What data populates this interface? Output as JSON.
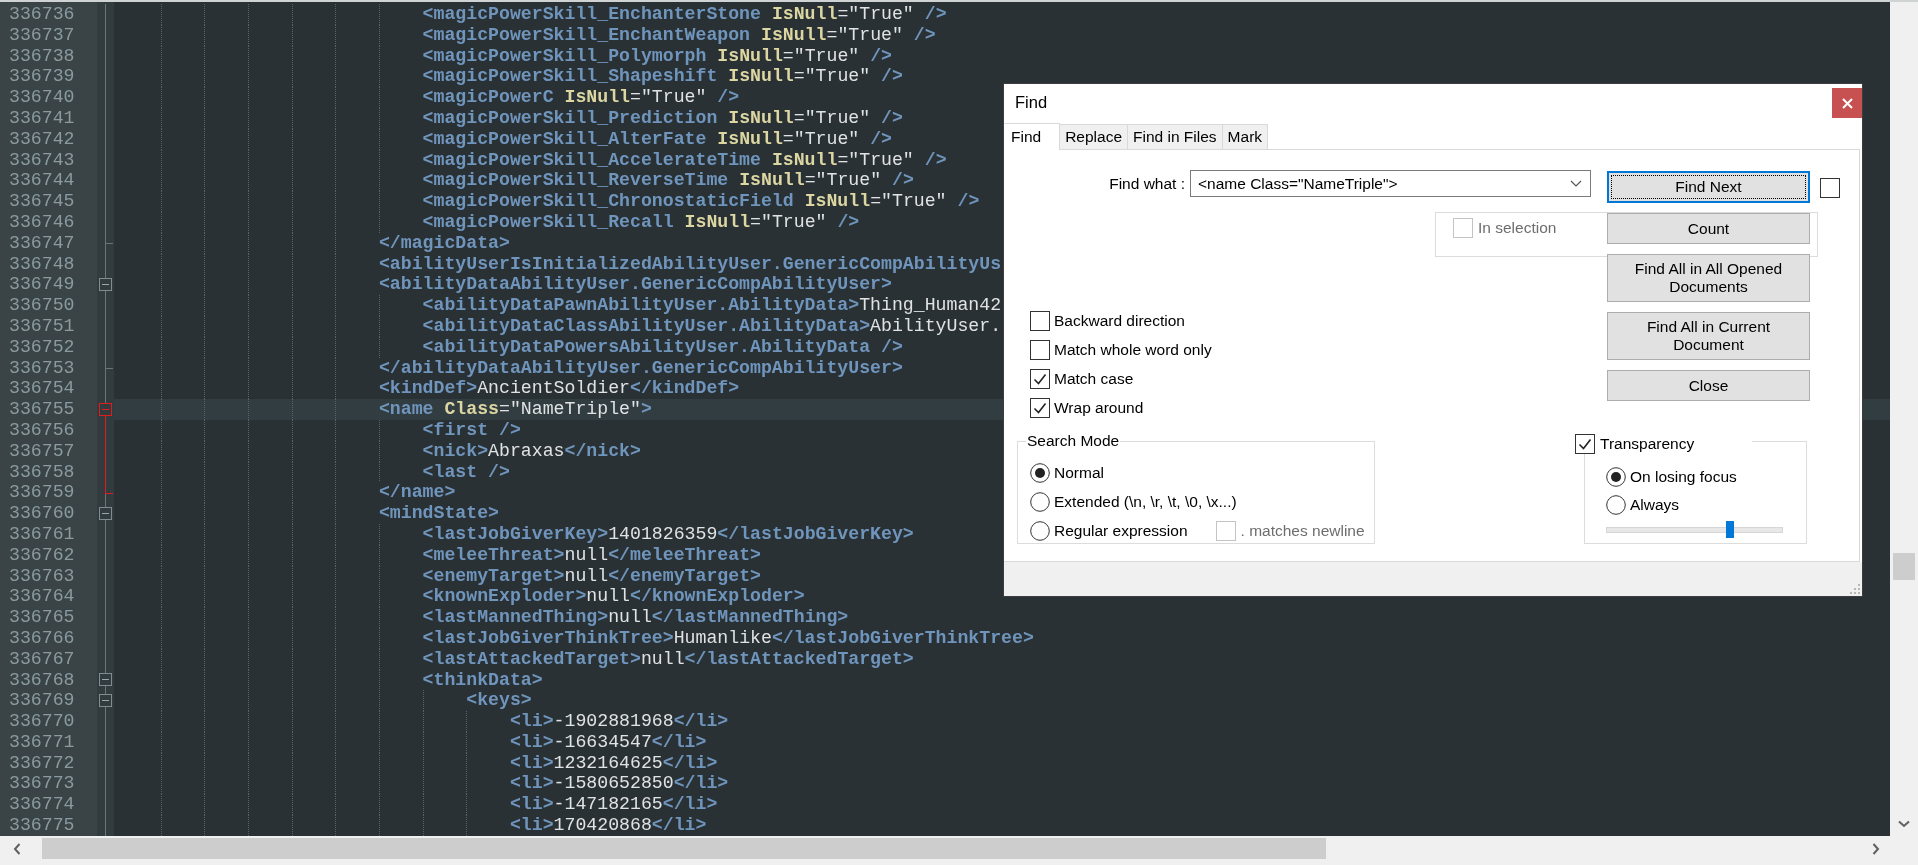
{
  "editor": {
    "lines": [
      {
        "number": "336736",
        "text": "\t\t\t\t\t\t\t<magicPowerSkill_EnchanterStone IsNull=\"True\" />",
        "kind": "plain",
        "current": false,
        "fold_highlight": false
      },
      {
        "number": "336737",
        "text": "\t\t\t\t\t\t\t<magicPowerSkill_EnchantWeapon IsNull=\"True\" />",
        "kind": "plain",
        "current": false,
        "fold_highlight": false
      },
      {
        "number": "336738",
        "text": "\t\t\t\t\t\t\t<magicPowerSkill_Polymorph IsNull=\"True\" />",
        "kind": "plain",
        "current": false,
        "fold_highlight": false
      },
      {
        "number": "336739",
        "text": "\t\t\t\t\t\t\t<magicPowerSkill_Shapeshift IsNull=\"True\" />",
        "kind": "plain",
        "current": false,
        "fold_highlight": false
      },
      {
        "number": "336740",
        "text": "\t\t\t\t\t\t\t<magicPowerC IsNull=\"True\" />",
        "kind": "plain",
        "current": false,
        "fold_highlight": false
      },
      {
        "number": "336741",
        "text": "\t\t\t\t\t\t\t<magicPowerSkill_Prediction IsNull=\"True\" />",
        "kind": "plain",
        "current": false,
        "fold_highlight": false
      },
      {
        "number": "336742",
        "text": "\t\t\t\t\t\t\t<magicPowerSkill_AlterFate IsNull=\"True\" />",
        "kind": "plain",
        "current": false,
        "fold_highlight": false
      },
      {
        "number": "336743",
        "text": "\t\t\t\t\t\t\t<magicPowerSkill_AccelerateTime IsNull=\"True\" />",
        "kind": "plain",
        "current": false,
        "fold_highlight": false
      },
      {
        "number": "336744",
        "text": "\t\t\t\t\t\t\t<magicPowerSkill_ReverseTime IsNull=\"True\" />",
        "kind": "plain",
        "current": false,
        "fold_highlight": false
      },
      {
        "number": "336745",
        "text": "\t\t\t\t\t\t\t<magicPowerSkill_ChronostaticField IsNull=\"True\" />",
        "kind": "plain",
        "current": false,
        "fold_highlight": false
      },
      {
        "number": "336746",
        "text": "\t\t\t\t\t\t\t<magicPowerSkill_Recall IsNull=\"True\" />",
        "kind": "plain",
        "current": false,
        "fold_highlight": false
      },
      {
        "number": "336747",
        "text": "\t\t\t\t\t\t</magicData>",
        "kind": "fold_end",
        "current": false,
        "fold_highlight": false
      },
      {
        "number": "336748",
        "text": "\t\t\t\t\t\t<abilityUserIsInitializedAbilityUser.GenericCompAbilityUs",
        "kind": "plain",
        "current": false,
        "fold_highlight": false
      },
      {
        "number": "336749",
        "text": "\t\t\t\t\t\t<abilityDataAbilityUser.GenericCompAbilityUser>",
        "kind": "fold_open",
        "current": false,
        "fold_highlight": false
      },
      {
        "number": "336750",
        "text": "\t\t\t\t\t\t\t<abilityDataPawnAbilityUser.AbilityData>Thing_Human42",
        "kind": "plain",
        "current": false,
        "fold_highlight": false
      },
      {
        "number": "336751",
        "text": "\t\t\t\t\t\t\t<abilityDataClassAbilityUser.AbilityData>AbilityUser.",
        "kind": "plain",
        "current": false,
        "fold_highlight": false
      },
      {
        "number": "336752",
        "text": "\t\t\t\t\t\t\t<abilityDataPowersAbilityUser.AbilityData />",
        "kind": "plain",
        "current": false,
        "fold_highlight": false
      },
      {
        "number": "336753",
        "text": "\t\t\t\t\t\t</abilityDataAbilityUser.GenericCompAbilityUser>",
        "kind": "fold_end",
        "current": false,
        "fold_highlight": false
      },
      {
        "number": "336754",
        "text": "\t\t\t\t\t\t<kindDef>AncientSoldier</kindDef>",
        "kind": "plain",
        "current": false,
        "fold_highlight": false
      },
      {
        "number": "336755",
        "text": "\t\t\t\t\t\t<name Class=\"NameTriple\">",
        "kind": "fold_open",
        "current": true,
        "fold_highlight": true
      },
      {
        "number": "336756",
        "text": "\t\t\t\t\t\t\t<first />",
        "kind": "plain",
        "current": false,
        "fold_highlight": true
      },
      {
        "number": "336757",
        "text": "\t\t\t\t\t\t\t<nick>Abraxas</nick>",
        "kind": "plain",
        "current": false,
        "fold_highlight": true
      },
      {
        "number": "336758",
        "text": "\t\t\t\t\t\t\t<last />",
        "kind": "plain",
        "current": false,
        "fold_highlight": true
      },
      {
        "number": "336759",
        "text": "\t\t\t\t\t\t</name>",
        "kind": "fold_end",
        "current": false,
        "fold_highlight": true
      },
      {
        "number": "336760",
        "text": "\t\t\t\t\t\t<mindState>",
        "kind": "fold_open",
        "current": false,
        "fold_highlight": false
      },
      {
        "number": "336761",
        "text": "\t\t\t\t\t\t\t<lastJobGiverKey>1401826359</lastJobGiverKey>",
        "kind": "plain",
        "current": false,
        "fold_highlight": false
      },
      {
        "number": "336762",
        "text": "\t\t\t\t\t\t\t<meleeThreat>null</meleeThreat>",
        "kind": "plain",
        "current": false,
        "fold_highlight": false
      },
      {
        "number": "336763",
        "text": "\t\t\t\t\t\t\t<enemyTarget>null</enemyTarget>",
        "kind": "plain",
        "current": false,
        "fold_highlight": false
      },
      {
        "number": "336764",
        "text": "\t\t\t\t\t\t\t<knownExploder>null</knownExploder>",
        "kind": "plain",
        "current": false,
        "fold_highlight": false
      },
      {
        "number": "336765",
        "text": "\t\t\t\t\t\t\t<lastMannedThing>null</lastMannedThing>",
        "kind": "plain",
        "current": false,
        "fold_highlight": false
      },
      {
        "number": "336766",
        "text": "\t\t\t\t\t\t\t<lastJobGiverThinkTree>Humanlike</lastJobGiverThinkTree>",
        "kind": "plain",
        "current": false,
        "fold_highlight": false
      },
      {
        "number": "336767",
        "text": "\t\t\t\t\t\t\t<lastAttackedTarget>null</lastAttackedTarget>",
        "kind": "plain",
        "current": false,
        "fold_highlight": false
      },
      {
        "number": "336768",
        "text": "\t\t\t\t\t\t\t<thinkData>",
        "kind": "fold_open",
        "current": false,
        "fold_highlight": false
      },
      {
        "number": "336769",
        "text": "\t\t\t\t\t\t\t\t<keys>",
        "kind": "fold_open",
        "current": false,
        "fold_highlight": false
      },
      {
        "number": "336770",
        "text": "\t\t\t\t\t\t\t\t\t<li>-1902881968</li>",
        "kind": "plain",
        "current": false,
        "fold_highlight": false
      },
      {
        "number": "336771",
        "text": "\t\t\t\t\t\t\t\t\t<li>-16634547</li>",
        "kind": "plain",
        "current": false,
        "fold_highlight": false
      },
      {
        "number": "336772",
        "text": "\t\t\t\t\t\t\t\t\t<li>1232164625</li>",
        "kind": "plain",
        "current": false,
        "fold_highlight": false
      },
      {
        "number": "336773",
        "text": "\t\t\t\t\t\t\t\t\t<li>-1580652850</li>",
        "kind": "plain",
        "current": false,
        "fold_highlight": false
      },
      {
        "number": "336774",
        "text": "\t\t\t\t\t\t\t\t\t<li>-147182165</li>",
        "kind": "plain",
        "current": false,
        "fold_highlight": false
      },
      {
        "number": "336775",
        "text": "\t\t\t\t\t\t\t\t\t<li>170420868</li>",
        "kind": "plain",
        "current": false,
        "fold_highlight": false
      }
    ]
  },
  "find_dialog": {
    "title": "Find",
    "tabs": [
      {
        "label": "Find",
        "selected": true
      },
      {
        "label": "Replace",
        "selected": false
      },
      {
        "label": "Find in Files",
        "selected": false
      },
      {
        "label": "Mark",
        "selected": false
      }
    ],
    "find_what": {
      "label": "Find what :",
      "value": "<name Class=\"NameTriple\">"
    },
    "in_selection": {
      "label": "In selection",
      "checked": false,
      "disabled": true
    },
    "options": [
      {
        "label": "Backward direction",
        "checked": false
      },
      {
        "label": "Match whole word only",
        "checked": false
      },
      {
        "label": "Match case",
        "checked": true
      },
      {
        "label": "Wrap around",
        "checked": true
      }
    ],
    "search_mode": {
      "title": "Search Mode",
      "modes": [
        {
          "label": "Normal",
          "selected": true
        },
        {
          "label": "Extended (\\n, \\r, \\t, \\0, \\x...)",
          "selected": false
        },
        {
          "label": "Regular expression",
          "selected": false
        }
      ],
      "matches_newline": {
        "label": ". matches newline",
        "checked": false,
        "disabled": true
      }
    },
    "buttons": [
      {
        "label": "Find Next",
        "focused": true
      },
      {
        "label": "Count",
        "focused": false
      },
      {
        "label": "Find All in All Opened Documents",
        "focused": false
      },
      {
        "label": "Find All in Current Document",
        "focused": false
      },
      {
        "label": "Close",
        "focused": false
      }
    ],
    "side_option": {
      "checked": false
    },
    "transparency": {
      "label": "Transparency",
      "checked": true,
      "modes": [
        {
          "label": "On losing focus",
          "selected": true
        },
        {
          "label": "Always",
          "selected": false
        }
      ],
      "level": 0.7
    }
  }
}
